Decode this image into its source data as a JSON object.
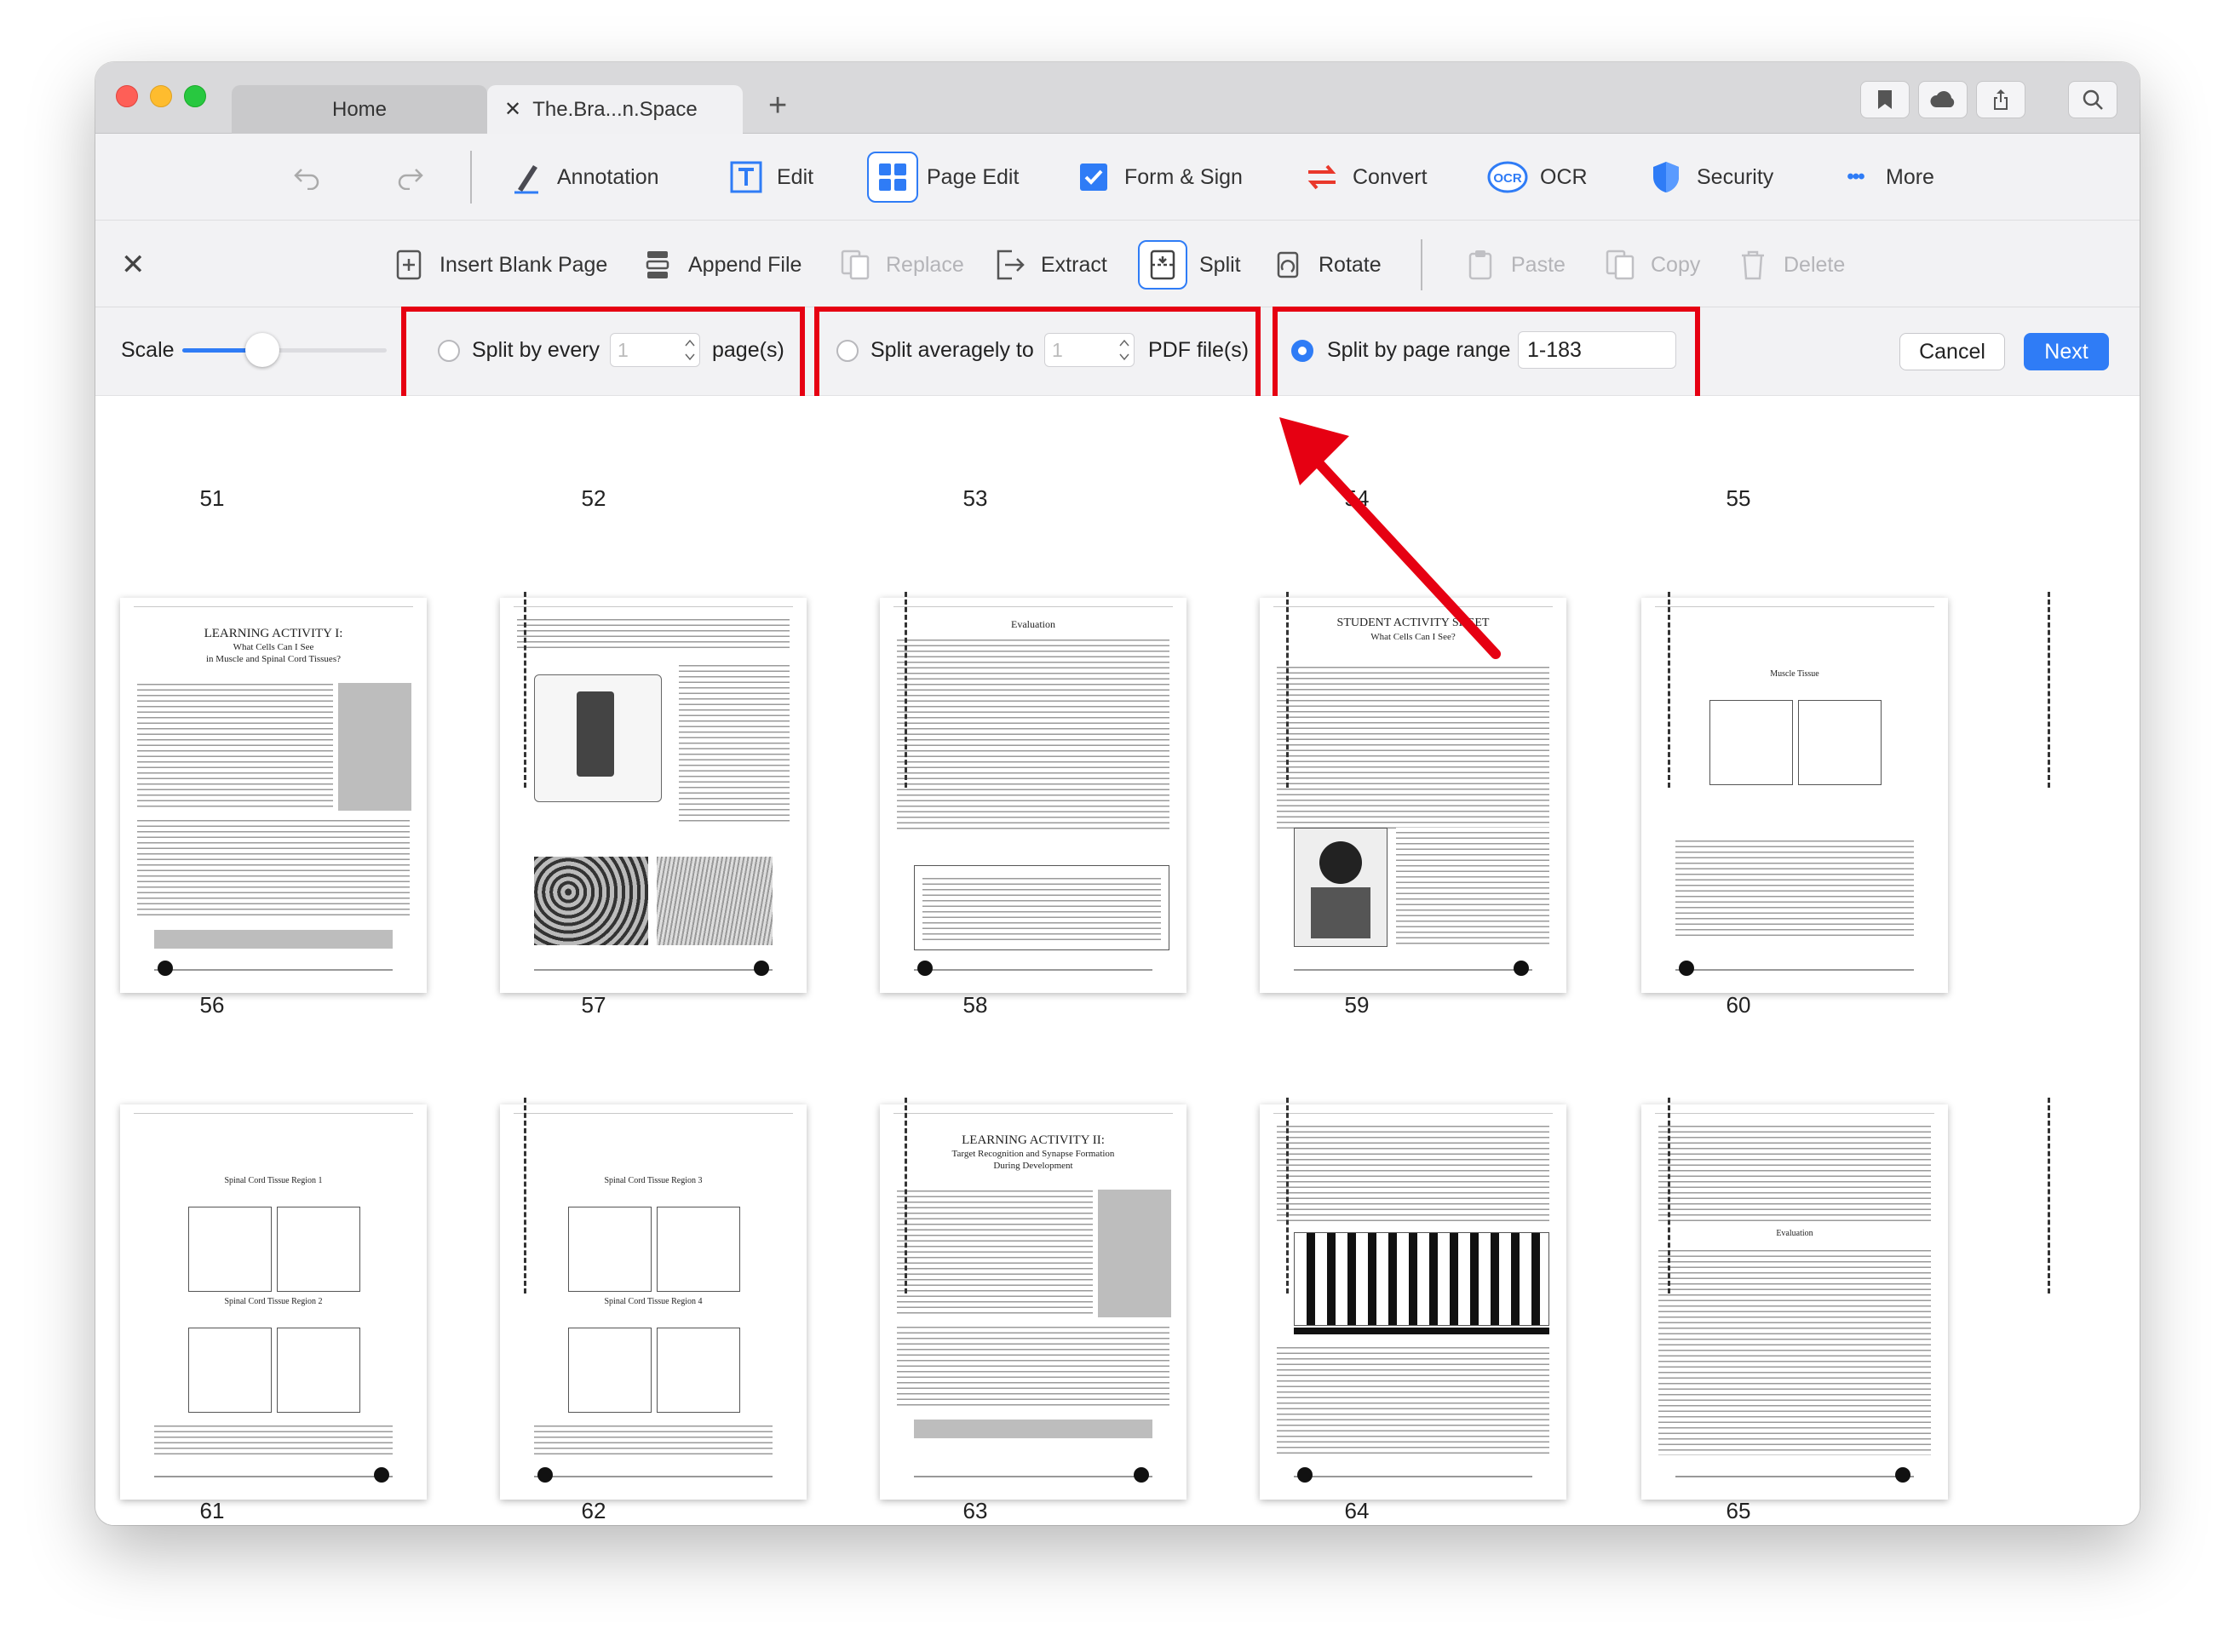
{
  "tabs": {
    "home": "Home",
    "document": "The.Bra...n.Space",
    "close_glyph": "✕",
    "new_tab_glyph": "+"
  },
  "titlebar_tools": [
    "bookmark-icon",
    "cloud-icon",
    "share-icon",
    "search-icon"
  ],
  "main_toolbar": {
    "annotation": "Annotation",
    "edit": "Edit",
    "page_edit": "Page Edit",
    "form_sign": "Form & Sign",
    "convert": "Convert",
    "ocr": "OCR",
    "security": "Security",
    "more": "More",
    "ocr_badge": "OCR",
    "more_glyph": "•••"
  },
  "page_toolbar": {
    "close_glyph": "✕",
    "insert_blank_page": "Insert Blank Page",
    "append_file": "Append File",
    "replace": "Replace",
    "extract": "Extract",
    "split": "Split",
    "rotate": "Rotate",
    "paste": "Paste",
    "copy": "Copy",
    "delete": "Delete"
  },
  "split_options": {
    "scale_label": "Scale",
    "scale_value": 0.39,
    "by_every": {
      "label": "Split by every",
      "value": "1",
      "suffix": "page(s)",
      "selected": false
    },
    "averagely": {
      "label": "Split averagely to",
      "value": "1",
      "suffix": "PDF file(s)",
      "selected": false
    },
    "by_range": {
      "label": "Split by page range",
      "value": "1-183",
      "selected": true
    },
    "cancel": "Cancel",
    "next": "Next"
  },
  "colors": {
    "accent": "#2f7cf6",
    "highlight": "#e60012",
    "toolbar": "#f2f2f4"
  },
  "pages": {
    "row1_numbers": [
      "51",
      "52",
      "53",
      "54",
      "55"
    ],
    "row2_numbers": [
      "56",
      "57",
      "58",
      "59",
      "60"
    ],
    "row3_numbers": [
      "61",
      "62",
      "63",
      "64",
      "65"
    ],
    "p56": {
      "title": "LEARNING ACTIVITY I:",
      "subtitle": "What Cells Can I See",
      "subtitle2": "in Muscle and Spinal Cord Tissues?"
    },
    "p58": {
      "title": "Evaluation"
    },
    "p59": {
      "title": "STUDENT ACTIVITY SHEET",
      "subtitle": "What Cells Can I See?"
    },
    "p60": {
      "title": "Muscle Tissue"
    },
    "p61": {
      "title": "Spinal Cord Tissue Region 1",
      "subtitle": "Spinal Cord Tissue Region 2"
    },
    "p62": {
      "title": "Spinal Cord Tissue Region 3",
      "subtitle": "Spinal Cord Tissue Region 4"
    },
    "p63": {
      "title": "LEARNING ACTIVITY II:",
      "subtitle": "Target Recognition and Synapse Formation",
      "subtitle2": "During Development"
    },
    "p65": {
      "title": "Evaluation"
    }
  }
}
